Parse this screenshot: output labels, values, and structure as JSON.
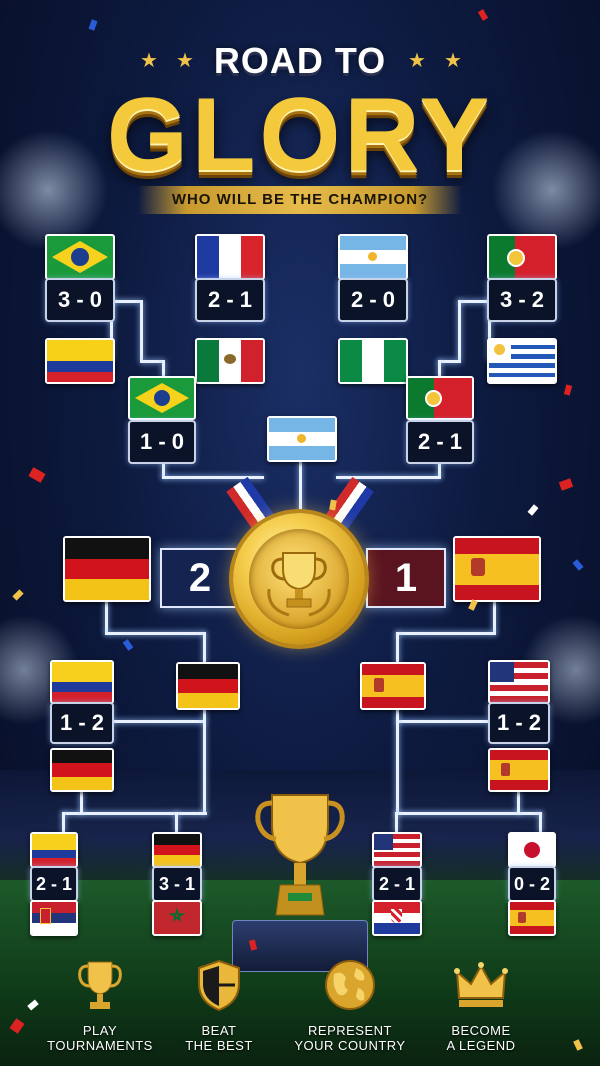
{
  "title": {
    "line1": "ROAD TO",
    "line2": "GLORY",
    "subtitle": "WHO WILL BE THE CHAMPION?"
  },
  "bracket": {
    "round1_top": [
      {
        "team_a": "Brazil",
        "team_b": "Ecuador",
        "score": "3 - 0"
      },
      {
        "team_a": "France",
        "team_b": "Mexico",
        "score": "2 - 1"
      },
      {
        "team_a": "Argentina",
        "team_b": "Nigeria",
        "score": "2 - 0"
      },
      {
        "team_a": "Portugal",
        "team_b": "Uruguay",
        "score": "3 - 2"
      }
    ],
    "round2_top": [
      {
        "team_a": "Brazil",
        "team_b": "France",
        "score": "1 - 0"
      },
      {
        "team_a": "Portugal",
        "team_b": "Argentina",
        "score": "2 - 1"
      }
    ],
    "semifinal_top_winner": "Argentina",
    "final": {
      "left_team": "Germany",
      "left_score": "2",
      "right_team": "Spain",
      "right_score": "1"
    },
    "round2_bottom": [
      {
        "team_a": "Colombia",
        "team_b": "Germany",
        "score": "1 - 2"
      },
      {
        "team_a": "USA",
        "team_b": "Spain",
        "score": "1 - 2"
      }
    ],
    "round1_bottom": [
      {
        "team_a": "Colombia",
        "team_b": "Serbia",
        "score": "2 - 1"
      },
      {
        "team_a": "Germany",
        "team_b": "Morocco",
        "score": "3 - 1"
      },
      {
        "team_a": "USA",
        "team_b": "Croatia",
        "score": "2 - 1"
      },
      {
        "team_a": "Japan",
        "team_b": "Spain",
        "score": "0 - 2"
      }
    ]
  },
  "features": [
    {
      "icon": "trophy-icon",
      "line1": "PLAY",
      "line2": "TOURNAMENTS"
    },
    {
      "icon": "shield-icon",
      "line1": "BEAT",
      "line2": "THE BEST"
    },
    {
      "icon": "globe-icon",
      "line1": "REPRESENT",
      "line2": "YOUR COUNTRY"
    },
    {
      "icon": "crown-icon",
      "line1": "BECOME",
      "line2": "A LEGEND"
    }
  ],
  "colors": {
    "gold": "#f4c93c",
    "background": "#0d1a3f",
    "final_left_box": "#14234f",
    "final_right_box": "#5a1420"
  }
}
